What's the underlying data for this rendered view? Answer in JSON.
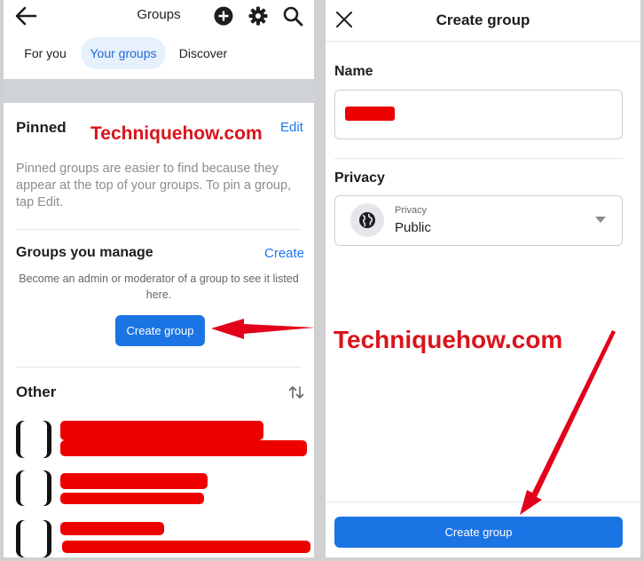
{
  "left": {
    "header": {
      "title": "Groups"
    },
    "tabs": [
      {
        "label": "For you",
        "active": false
      },
      {
        "label": "Your groups",
        "active": true
      },
      {
        "label": "Discover",
        "active": false
      }
    ],
    "pinned": {
      "title": "Pinned",
      "edit_label": "Edit",
      "description": "Pinned groups are easier to find because they appear at the top of your groups. To pin a group, tap Edit."
    },
    "manage": {
      "title": "Groups you manage",
      "create_label": "Create",
      "description": "Become an admin or moderator of a group to see it listed here.",
      "create_group_button": "Create group"
    },
    "other": {
      "title": "Other"
    }
  },
  "right": {
    "header": {
      "title": "Create group"
    },
    "name_label": "Name",
    "privacy_label": "Privacy",
    "privacy_select": {
      "small_label": "Privacy",
      "value": "Public"
    },
    "create_group_button": "Create group"
  },
  "watermark": "Techniquehow.com",
  "colors": {
    "accent": "#1877f2",
    "redaction": "#ec0000",
    "arrow": "#e2001a"
  }
}
